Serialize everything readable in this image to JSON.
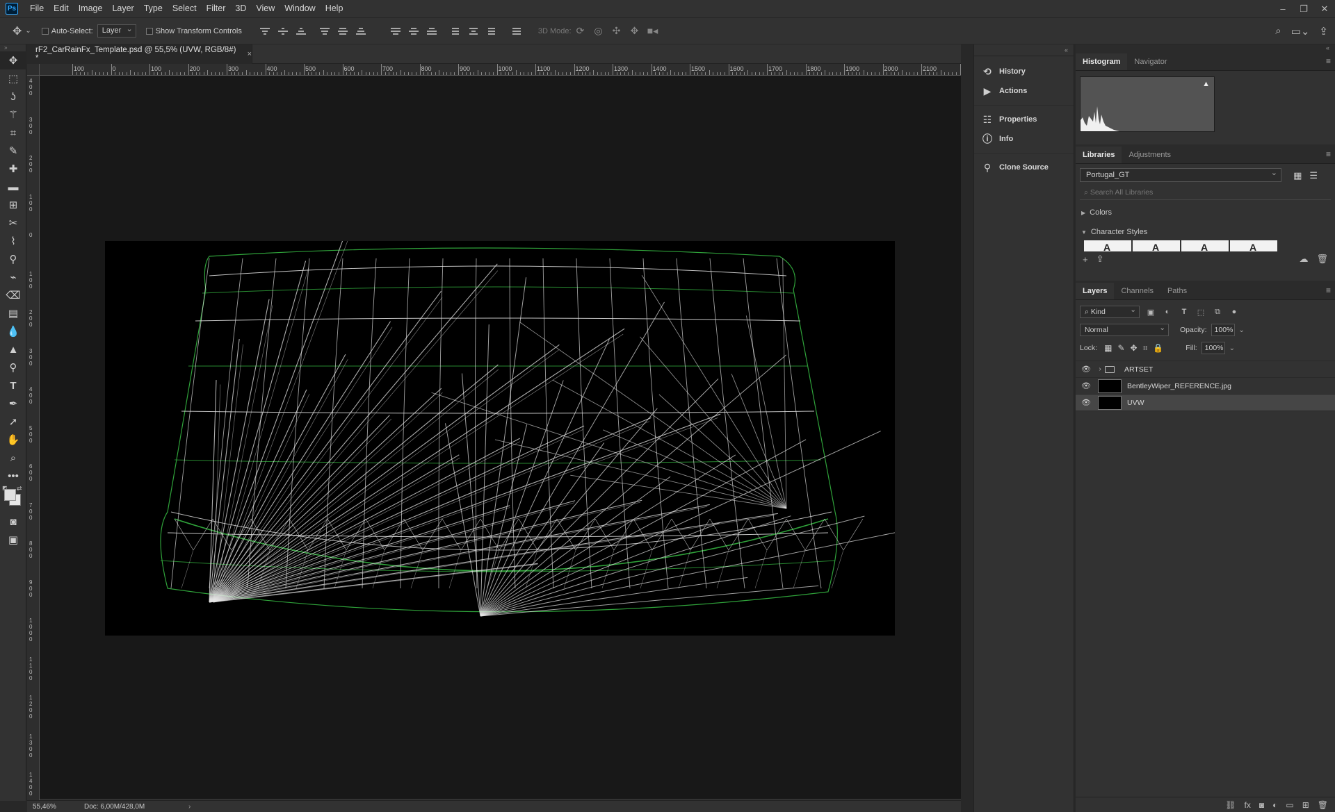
{
  "app": {
    "logo_text": "Ps"
  },
  "menu": [
    "File",
    "Edit",
    "Image",
    "Layer",
    "Type",
    "Select",
    "Filter",
    "3D",
    "View",
    "Window",
    "Help"
  ],
  "options_bar": {
    "auto_select_label": "Auto-Select:",
    "auto_select_target": "Layer",
    "show_transform_label": "Show Transform Controls",
    "mode3d_label": "3D Mode:"
  },
  "document": {
    "tab_title": "rF2_CarRainFx_Template.psd @ 55,5% (UVW, RGB/8#) *",
    "close_glyph": "×"
  },
  "ruler": {
    "top_labels": [
      "100",
      "0",
      "100",
      "200",
      "300",
      "400",
      "500",
      "600",
      "700",
      "800",
      "900",
      "1000",
      "1100",
      "1200",
      "1300",
      "1400",
      "1500",
      "1600",
      "1700",
      "1800",
      "1900",
      "2000",
      "2100",
      "2"
    ],
    "left_labels": [
      "400",
      "300",
      "200",
      "100",
      "0",
      "100",
      "200",
      "300",
      "400",
      "500",
      "600",
      "700",
      "800",
      "900",
      "1000",
      "1100",
      "1200",
      "1300",
      "1400"
    ]
  },
  "status": {
    "zoom": "55,46%",
    "doc": "Doc: 6,00M/428,0M",
    "arrow": "›"
  },
  "collapsed_panels": [
    {
      "label": "History",
      "icon": "history-icon",
      "glyph": "⟲"
    },
    {
      "label": "Actions",
      "icon": "actions-icon",
      "glyph": "▶"
    },
    {
      "label": "Properties",
      "icon": "properties-icon",
      "glyph": "☷"
    },
    {
      "label": "Info",
      "icon": "info-icon",
      "glyph": "ⓘ"
    },
    {
      "label": "Clone Source",
      "icon": "clone-source-icon",
      "glyph": "⚲"
    }
  ],
  "histogram_panel": {
    "tabs": [
      "Histogram",
      "Navigator"
    ],
    "warning_glyph": "▲"
  },
  "libraries_panel": {
    "tabs": [
      "Libraries",
      "Adjustments"
    ],
    "library_name": "Portugal_GT",
    "search_placeholder": "Search All Libraries",
    "sections": [
      "Colors",
      "Character Styles"
    ]
  },
  "layers_panel": {
    "tabs": [
      "Layers",
      "Channels",
      "Paths"
    ],
    "kind_filter": "Kind",
    "blend_mode": "Normal",
    "opacity_label": "Opacity:",
    "opacity_value": "100%",
    "lock_label": "Lock:",
    "fill_label": "Fill:",
    "fill_value": "100%",
    "layers": [
      {
        "name": "ARTSET",
        "type": "group",
        "visible": true,
        "selected": false
      },
      {
        "name": "BentleyWiper_REFERENCE.jpg",
        "type": "image",
        "visible": true,
        "selected": false
      },
      {
        "name": "UVW",
        "type": "image",
        "visible": true,
        "selected": true
      }
    ]
  },
  "colors": {
    "foreground": "#e0e0e0",
    "background": "#e8e8e8",
    "wire_green": "#2fa23a",
    "wire_white": "#e6e6e6"
  }
}
